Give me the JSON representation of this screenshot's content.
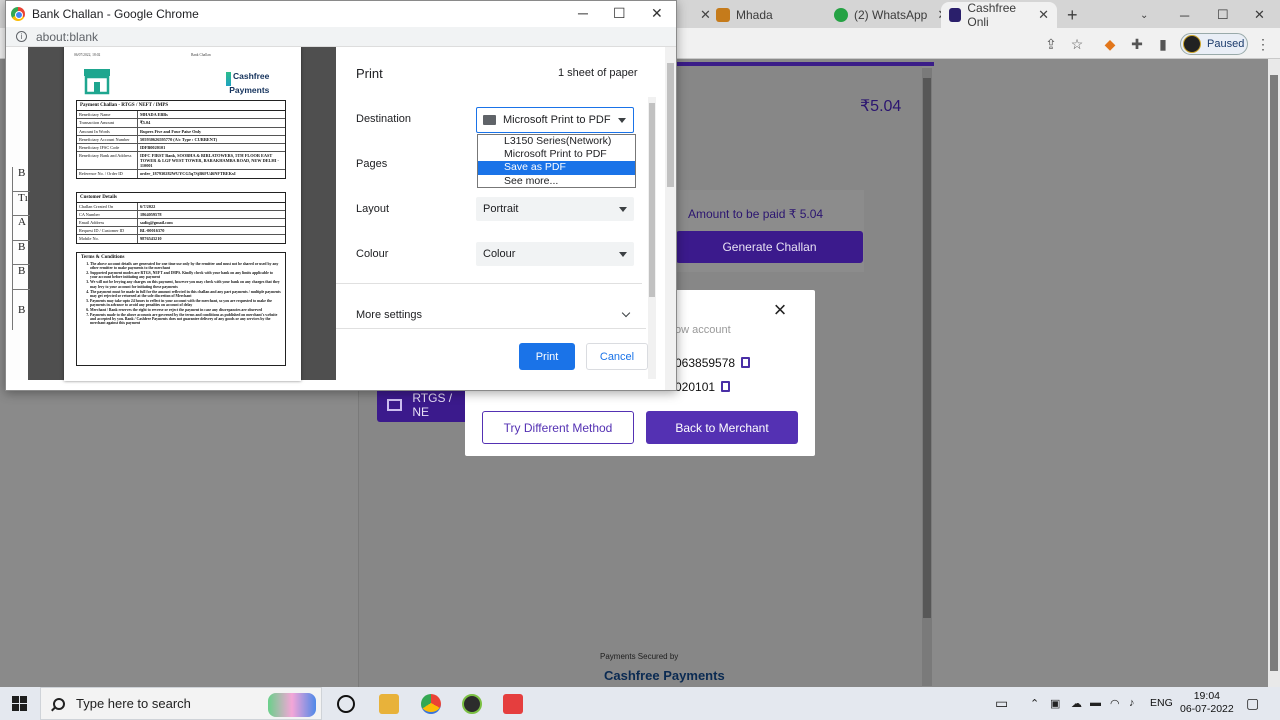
{
  "bg_browser": {
    "tabs": [
      {
        "label": "Mhada",
        "icon": "house-icon"
      },
      {
        "label": "(2) WhatsApp",
        "icon": "whatsapp-icon"
      },
      {
        "label": "Cashfree Onli",
        "icon": "cashfree-icon",
        "active": true
      }
    ],
    "profile_status": "Paused"
  },
  "merchant_page": {
    "amount_top": "₹5.04",
    "amount_to_pay": "Amount to be paid ₹ 5.04",
    "generate_challan": "Generate Challan",
    "rtgs_label": "RTGS / NE",
    "secured_by": "Payments Secured by",
    "secured_logo": "Cashfree Payments"
  },
  "modal": {
    "subtitle": "ow account",
    "account_number": "063859578",
    "ifsc_fragment": "020101",
    "try_different": "Try Different Method",
    "back_to_merchant": "Back to Merchant"
  },
  "print_window": {
    "title": "Bank Challan - Google Chrome",
    "address": "about:blank",
    "controls": {
      "minimize": "─",
      "maximize": "☐",
      "close": "✕"
    }
  },
  "challan": {
    "header_left": "06/07/2022, 18:02",
    "header_mid": "Bank Challan",
    "logo_text_1": "Cashfree",
    "logo_text_2": "Payments",
    "payment_title": "Payment Challan - RTGS / NEFT / IMPS",
    "payment_rows": [
      {
        "k": "Beneficiary Name",
        "v": "MHADA EBBs"
      },
      {
        "k": "Transaction Amount",
        "v": "₹5.04"
      },
      {
        "k": "Amount In Words",
        "v": "Rupees Five and Four Paise Only"
      },
      {
        "k": "Beneficiary Account Number",
        "v": "505930626595770 (A/c Type : CURRENT)"
      },
      {
        "k": "Beneficiary IFSC Code",
        "v": "IDFB0020101"
      },
      {
        "k": "Beneficiary Bank and Address",
        "v": "IDFC FIRST Bank, SOOBHA & BIRLATOWERS, 5TH FLOOR EAST TOWER & LGF WEST TOWER, BARAKHAMBA ROAD, NEW DELHI - 110001"
      },
      {
        "k": "Reference No. / Order ID",
        "v": "order_187930282WUYCG5q7SjB6FU46NFTBEKxI"
      }
    ],
    "customer_title": "Customer Details",
    "customer_rows": [
      {
        "k": "Challan Created On",
        "v": "6/7/2022"
      },
      {
        "k": "CA Number",
        "v": "1864059578"
      },
      {
        "k": "Email Address",
        "v": "sadiq@gmail.com"
      },
      {
        "k": "Request ID / Customer ID",
        "v": "BL-00016370"
      },
      {
        "k": "Mobile No.",
        "v": "9876543210"
      }
    ],
    "terms_title": "Terms & Conditions",
    "terms": [
      "The above account details are generated for one time use only by the remitter and must not be shared or used by any other remitter to make payments to the merchant",
      "Supported payment modes are RTGS, NEFT and IMPS. Kindly check with your bank on any limits applicable to your account before initiating any payment",
      "We will not be levying any charges on this payment, however you may check with your bank on any charges that they may levy to your account for initiating these payments",
      "The payment must be made in full for the amount reflected in this challan and any part payments / multiple payments may get rejected or returned at the sole discretion of Merchant",
      "Payments may take upto 24 hours to reflect in your account with the merchant, so you are requested to make the payments in advance to avoid any penalties on account of delay",
      "Merchant / Bank reserves the right to reverse or reject the payment in case any discrepancies are observed",
      "Payments made to the above accounts are governed by the terms and conditions as published on merchant's website and accepted by you. Bank / Cashfree Payments does not guarantee delivery of any goods or any services by the merchant against this payment"
    ],
    "strip_rows": [
      "B",
      "Tı",
      "A",
      "B",
      "B",
      "B"
    ]
  },
  "print_settings": {
    "title": "Print",
    "sheets": "1 sheet of paper",
    "destination_label": "Destination",
    "destination_value": "Microsoft Print to PDF",
    "destination_options": [
      "L3150 Series(Network)",
      "Microsoft Print to PDF",
      "Save as PDF",
      "See more..."
    ],
    "destination_highlight": "Save as PDF",
    "pages_label": "Pages",
    "layout_label": "Layout",
    "layout_value": "Portrait",
    "colour_label": "Colour",
    "colour_value": "Colour",
    "more_settings": "More settings",
    "print_button": "Print",
    "cancel_button": "Cancel"
  },
  "taskbar": {
    "search_placeholder": "Type here to search",
    "lang": "ENG",
    "time": "19:04",
    "date": "06-07-2022"
  },
  "colors": {
    "accent_purple": "#5431b3",
    "chrome_blue": "#1a73e8"
  }
}
